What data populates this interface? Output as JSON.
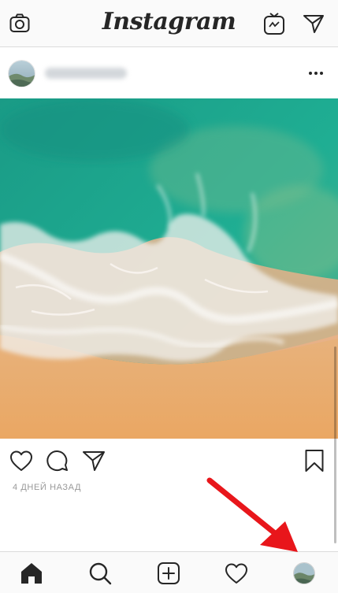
{
  "header": {
    "title": "Instagram",
    "left_icon": "camera-icon",
    "right_icons": [
      "igtv-icon",
      "direct-message-icon"
    ]
  },
  "post": {
    "username": "username_hidden",
    "more_icon": "more-options-icon",
    "image_subject": "aerial beach with turquoise sea and white surf",
    "action_icons": [
      "like-icon",
      "comment-icon",
      "share-icon",
      "save-icon"
    ],
    "timestamp": "4 ДНЕЙ НАЗАД"
  },
  "bottom_nav": {
    "items": [
      "home-icon",
      "search-icon",
      "new-post-icon",
      "activity-icon",
      "profile-avatar"
    ]
  },
  "annotation": {
    "arrow_color": "#e8161b",
    "points_to": "profile-avatar"
  },
  "colors": {
    "accent_bar_bg": "#fafafa",
    "border": "#dbdbdb",
    "icon": "#262626",
    "muted_text": "#999999"
  }
}
